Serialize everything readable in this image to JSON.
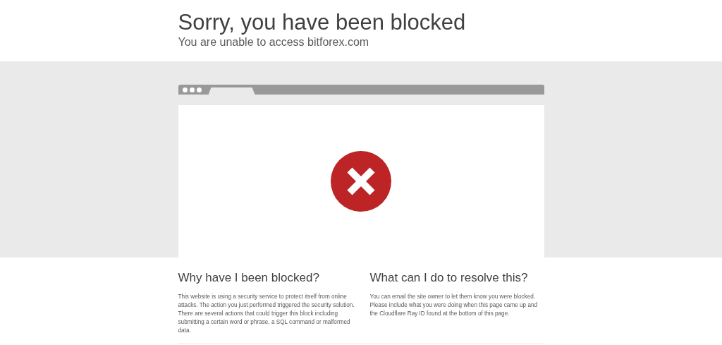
{
  "header": {
    "title": "Sorry, you have been blocked",
    "subtitle": "You are unable to access bitforex.com"
  },
  "sections": [
    {
      "heading": "Why have I been blocked?",
      "text": "This website is using a security service to protect itself from online attacks. The action you just performed triggered the security solution. There are several actions that could trigger this block including submitting a certain word or phrase, a SQL command or malformed data."
    },
    {
      "heading": "What can I do to resolve this?",
      "text": "You can email the site owner to let them know you were blocked. Please include what you were doing when this page came up and the Cloudflare Ray ID found at the bottom of this page."
    }
  ]
}
